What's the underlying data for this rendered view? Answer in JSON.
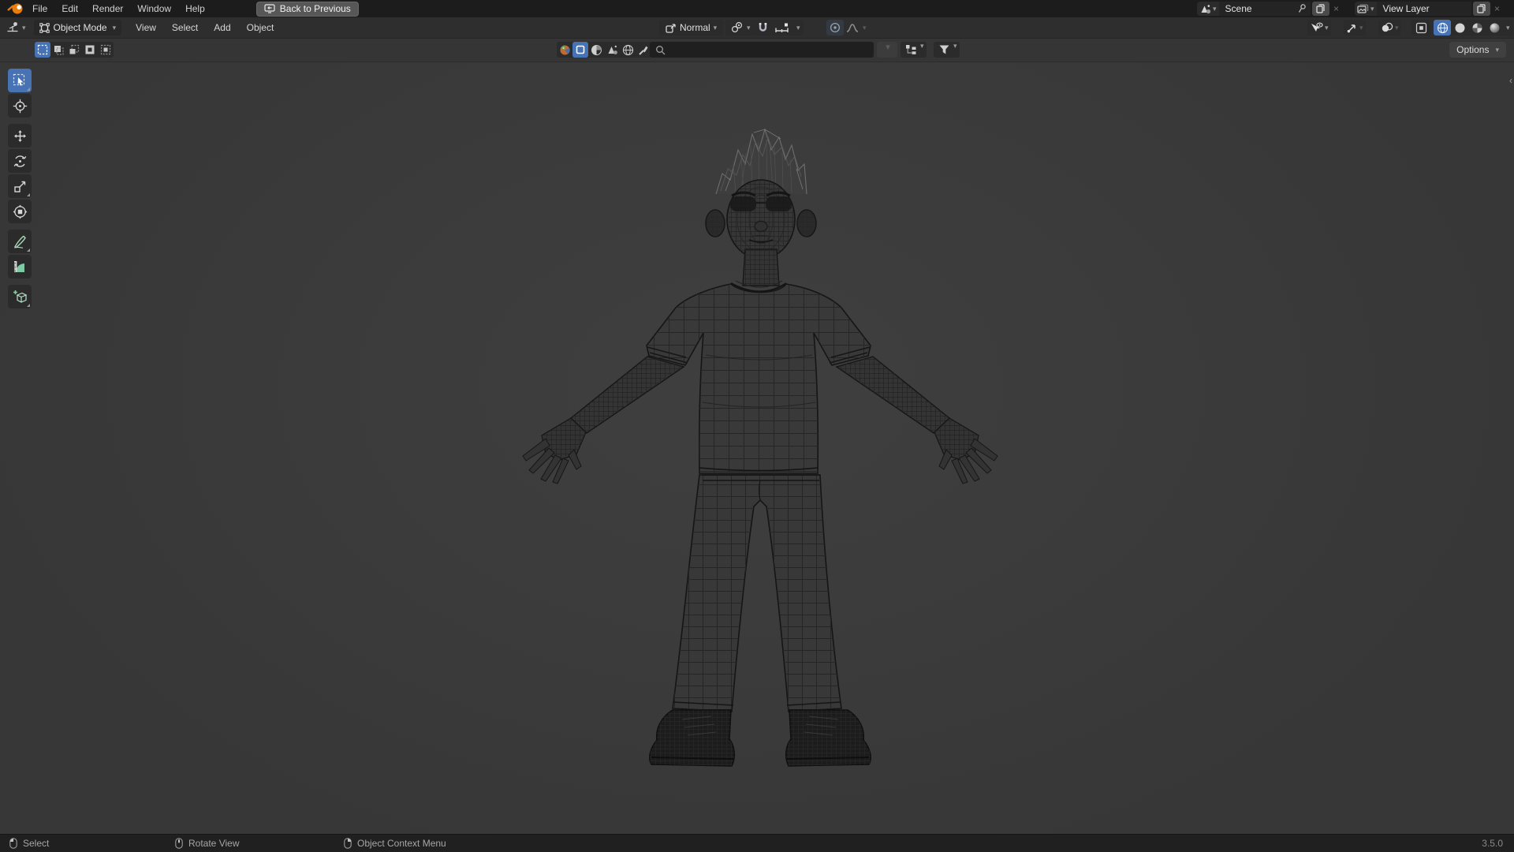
{
  "app": {
    "title": "Blender",
    "version": "3.5.0"
  },
  "topbar": {
    "menus": [
      "File",
      "Edit",
      "Render",
      "Window",
      "Help"
    ],
    "back_button_label": "Back to Previous",
    "scene_selector": {
      "value": "Scene",
      "icons": [
        "scene-icon",
        "dropdown-chevron",
        "pin-icon",
        "duplicate-icon",
        "close-icon"
      ]
    },
    "view_layer_selector": {
      "value": "View Layer",
      "icons": [
        "view-layer-icon",
        "dropdown-chevron",
        "duplicate-icon",
        "close-icon"
      ]
    }
  },
  "viewport_header": {
    "editor_type_icon": "editor-3d-viewport-icon",
    "mode_selector": {
      "value": "Object Mode",
      "icon": "object-mode-icon"
    },
    "menus": [
      "View",
      "Select",
      "Add",
      "Object"
    ],
    "transform_orientation": {
      "value": "Normal",
      "icon": "orientation-icon"
    },
    "right_icons": [
      "selectability-icon",
      "gizmo-icon",
      "overlays-icon",
      "xray-icon",
      "shading-wireframe-icon",
      "shading-solid-icon",
      "shading-material-icon",
      "shading-rendered-icon"
    ],
    "active_shading": "wireframe",
    "snapping": {
      "magnet_on": false,
      "snap_with_icon": "snap-increment-icon"
    },
    "proportional_editing_on": false
  },
  "tool_settings": {
    "select_mode_icons": [
      "mode-new-icon",
      "mode-extend-icon",
      "mode-subtract-icon",
      "mode-invert-icon",
      "mode-intersect-icon"
    ],
    "active_select_mode": "new",
    "filter_icons": [
      "material-ball-icon",
      "plane-icon",
      "contrast-icon",
      "scene-icon",
      "world-icon",
      "brush-icon"
    ],
    "active_filter": "plane-icon",
    "search": {
      "value": "",
      "placeholder": ""
    },
    "display_mode_icon": "hierarchy-icon",
    "filter_funnel_icon": "funnel-icon",
    "options_label": "Options"
  },
  "toolbar": {
    "active_tool": "select-box",
    "tools": [
      "select-box",
      "cursor",
      "move",
      "rotate",
      "scale",
      "transform",
      "annotate",
      "measure",
      "add-cube"
    ]
  },
  "viewport": {
    "content": "wireframe boy character model, A-pose, t-shirt, pants, sneakers",
    "sidebar_toggle": "‹"
  },
  "statusbar": {
    "hints": [
      {
        "icon": "mouse-left-icon",
        "label": "Select"
      },
      {
        "icon": "mouse-middle-icon",
        "label": "Rotate View"
      },
      {
        "icon": "mouse-right-icon",
        "label": "Object Context Menu"
      }
    ],
    "version": "3.5.0"
  },
  "colors": {
    "accent": "#4772b3",
    "topbar_bg": "#1c1c1c",
    "header_bg": "#2e2e2e",
    "tool_settings_bg": "#353535",
    "viewport_bg": "#3b3b3b",
    "statusbar_bg": "#202020",
    "logo_orange": "#e87d0d"
  }
}
